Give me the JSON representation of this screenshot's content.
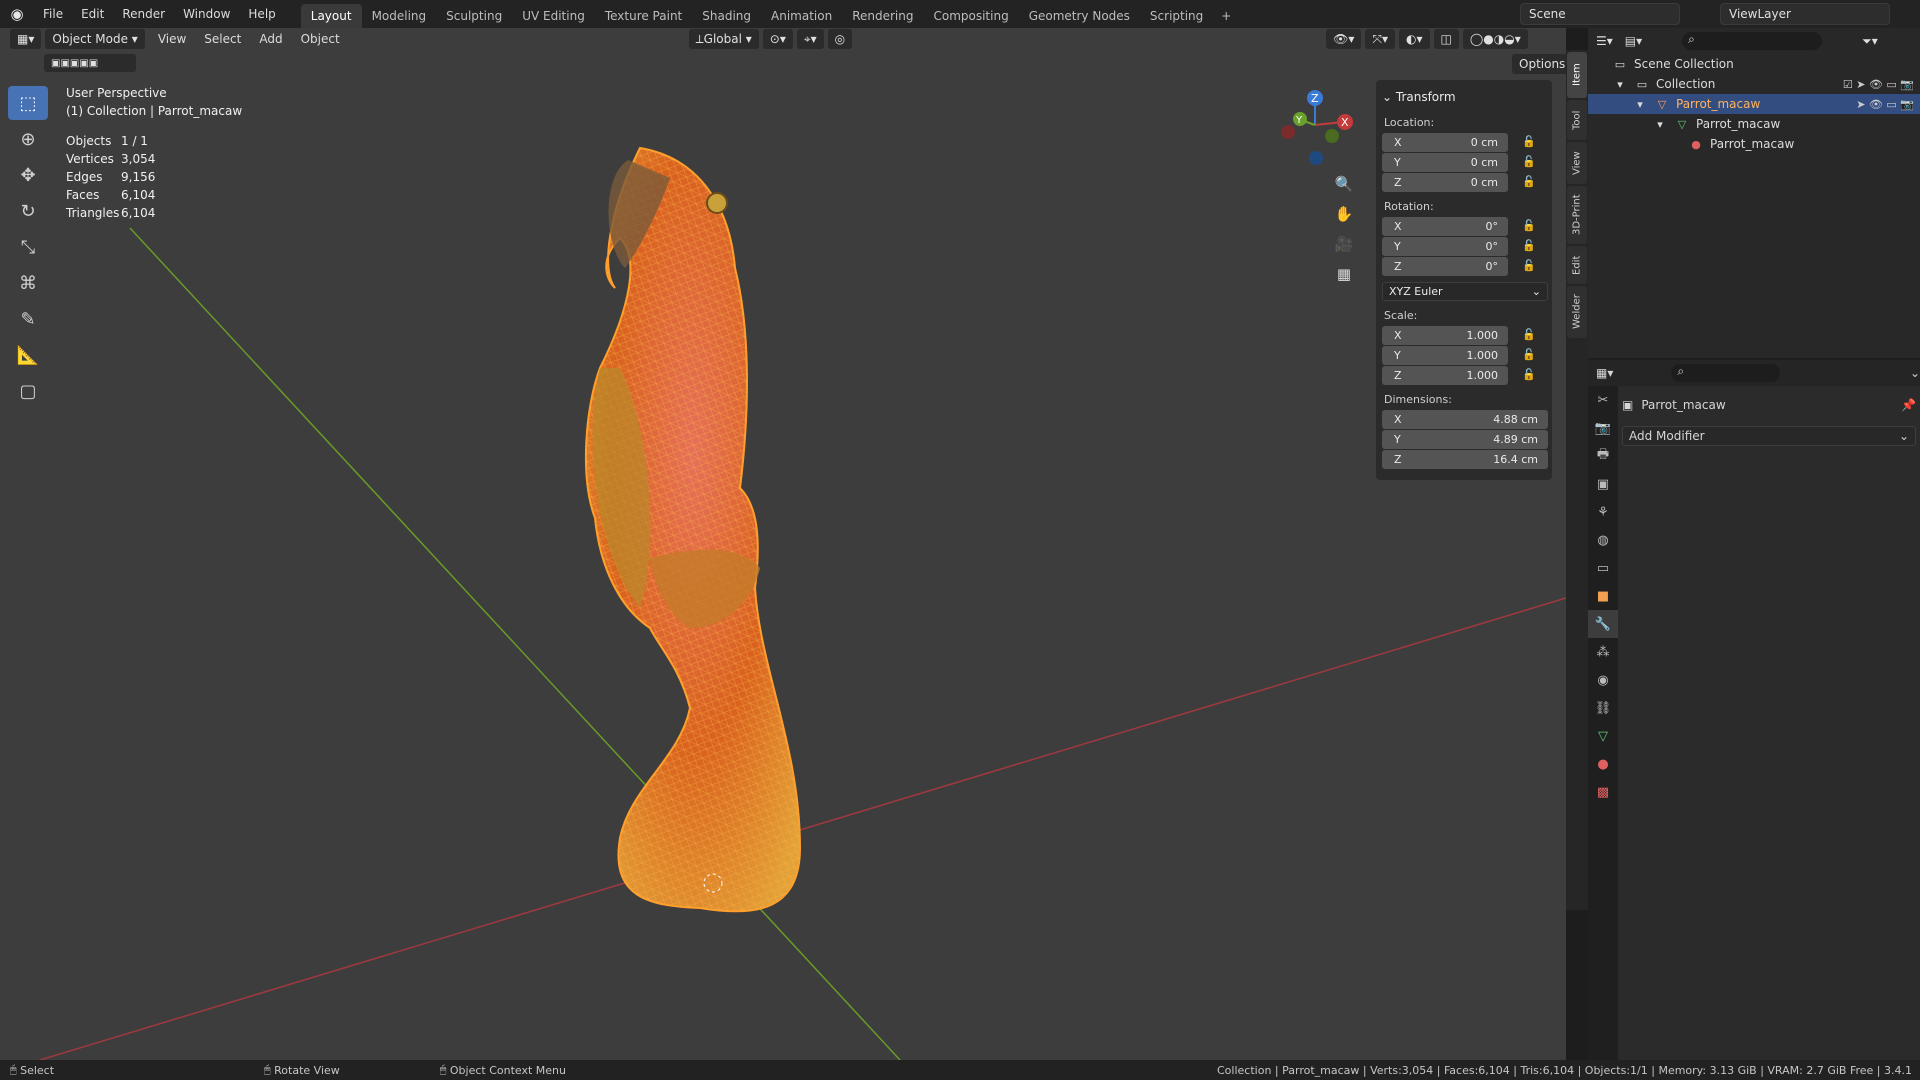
{
  "menu": [
    "File",
    "Edit",
    "Render",
    "Window",
    "Help"
  ],
  "workspaces": [
    "Layout",
    "Modeling",
    "Sculpting",
    "UV Editing",
    "Texture Paint",
    "Shading",
    "Animation",
    "Rendering",
    "Compositing",
    "Geometry Nodes",
    "Scripting"
  ],
  "active_workspace": "Layout",
  "scene": "Scene",
  "view_layer": "ViewLayer",
  "viewport": {
    "mode": "Object Mode",
    "menus": [
      "View",
      "Select",
      "Add",
      "Object"
    ],
    "orientation": "Global",
    "options": "Options",
    "perspective": "User Perspective",
    "collection_path": "(1) Collection | Parrot_macaw",
    "stats": [
      {
        "k": "Objects",
        "v": "1 / 1"
      },
      {
        "k": "Vertices",
        "v": "3,054"
      },
      {
        "k": "Edges",
        "v": "9,156"
      },
      {
        "k": "Faces",
        "v": "6,104"
      },
      {
        "k": "Triangles",
        "v": "6,104"
      }
    ]
  },
  "transform": {
    "title": "Transform",
    "location_label": "Location:",
    "location": [
      {
        "ax": "X",
        "v": "0 cm"
      },
      {
        "ax": "Y",
        "v": "0 cm"
      },
      {
        "ax": "Z",
        "v": "0 cm"
      }
    ],
    "rotation_label": "Rotation:",
    "rotation": [
      {
        "ax": "X",
        "v": "0°"
      },
      {
        "ax": "Y",
        "v": "0°"
      },
      {
        "ax": "Z",
        "v": "0°"
      }
    ],
    "rotation_mode": "XYZ Euler",
    "scale_label": "Scale:",
    "scale": [
      {
        "ax": "X",
        "v": "1.000"
      },
      {
        "ax": "Y",
        "v": "1.000"
      },
      {
        "ax": "Z",
        "v": "1.000"
      }
    ],
    "dimensions_label": "Dimensions:",
    "dimensions": [
      {
        "ax": "X",
        "v": "4.88 cm"
      },
      {
        "ax": "Y",
        "v": "4.89 cm"
      },
      {
        "ax": "Z",
        "v": "16.4 cm"
      }
    ]
  },
  "side_tabs": [
    "Item",
    "Tool",
    "View",
    "3D-Print",
    "Edit",
    "Welder"
  ],
  "outliner": {
    "scene_collection": "Scene Collection",
    "collection": "Collection",
    "object": "Parrot_macaw",
    "mesh": "Parrot_macaw",
    "material": "Parrot_macaw"
  },
  "properties": {
    "object_name": "Parrot_macaw",
    "add_modifier": "Add Modifier"
  },
  "status": {
    "select": "Select",
    "rotate": "Rotate View",
    "context": "Object Context Menu",
    "info": "Collection | Parrot_macaw | Verts:3,054 | Faces:6,104 | Tris:6,104 | Objects:1/1 | Memory: 3.13 GiB | VRAM: 2.7 GiB Free | 3.4.1"
  }
}
